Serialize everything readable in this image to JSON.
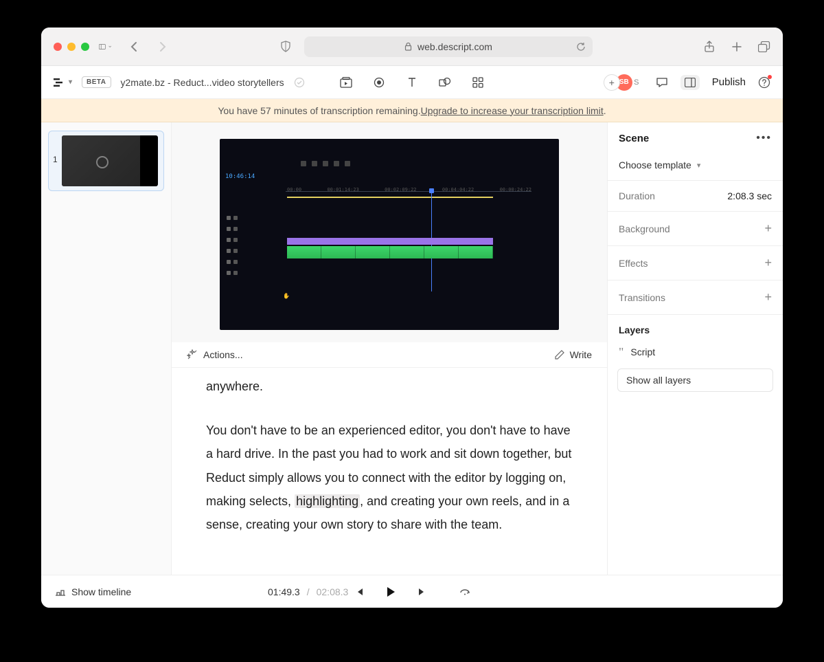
{
  "browser": {
    "url": "web.descript.com"
  },
  "app": {
    "beta": "BETA",
    "title": "y2mate.bz - Reduct...video storytellers",
    "avatar_b": "SB",
    "avatar_s": "S",
    "publish": "Publish"
  },
  "banner": {
    "prefix": "You have 57 minutes of transcription remaining. ",
    "link": "Upgrade to increase your transcription limit",
    "suffix": "."
  },
  "scenes": {
    "first_number": "1"
  },
  "preview": {
    "timecode": "10:46:14"
  },
  "actions": {
    "left": "Actions...",
    "right": "Write"
  },
  "transcript": {
    "line0": "anywhere.",
    "p2a": "You don't have to be an experienced editor, you don't have to have a hard drive. In the past you had to work and sit down together, but Reduct simply allows you to connect with the editor by logging on, making selects, ",
    "highlight": "highlighting",
    "p2b": ", and creating your own reels, and in a sense, creating your own story to share with the team."
  },
  "properties": {
    "title": "Scene",
    "template": "Choose template",
    "duration_label": "Duration",
    "duration_value": "2:08.3 sec",
    "background": "Background",
    "effects": "Effects",
    "transitions": "Transitions",
    "layers_title": "Layers",
    "layer_script": "Script",
    "show_all": "Show all layers"
  },
  "footer": {
    "show_timeline": "Show timeline",
    "current": "01:49.3",
    "total": "02:08.3"
  }
}
